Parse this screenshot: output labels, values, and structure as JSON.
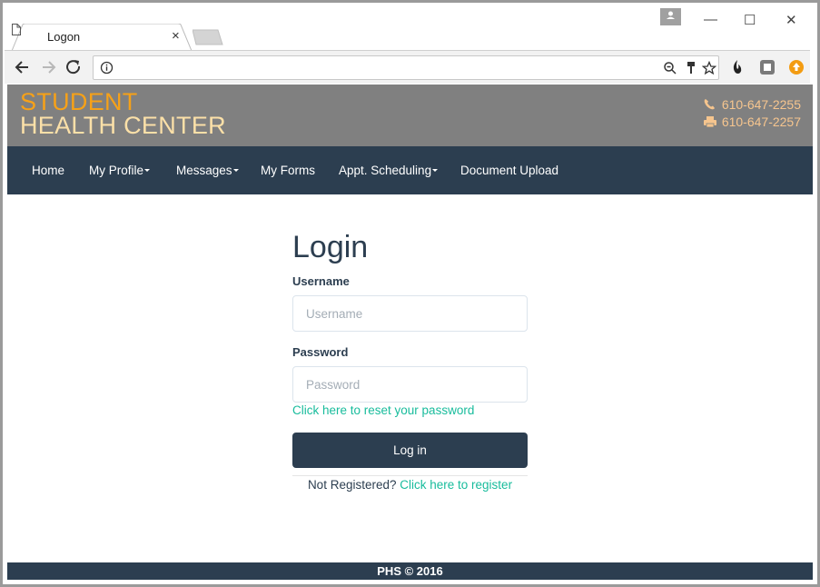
{
  "browser": {
    "tab_title": "Logon",
    "tab_close": "×",
    "window_controls": {
      "minimize": "—",
      "maximize": "☐",
      "close": "✕"
    },
    "address": {
      "value": ""
    },
    "icons": [
      "back-icon",
      "forward-icon",
      "reload-icon",
      "info-icon",
      "zoom-icon",
      "key-icon",
      "star-icon",
      "extension-flame-icon",
      "extension-square-icon",
      "extension-upload-icon"
    ]
  },
  "header": {
    "brand_line1": "STUDENT",
    "brand_line2": "HEALTH CENTER",
    "phone": "610-647-2255",
    "fax": "610-647-2257",
    "colors": {
      "brand_orange": "#f6a118",
      "brand_light": "#fbe0a8",
      "header_bg": "#808080"
    }
  },
  "nav": {
    "items": [
      {
        "label": "Home",
        "dropdown": false
      },
      {
        "label": "My Profile",
        "dropdown": true
      },
      {
        "label": "Messages",
        "dropdown": true
      },
      {
        "label": "My Forms",
        "dropdown": false
      },
      {
        "label": "Appt. Scheduling",
        "dropdown": true
      },
      {
        "label": "Document Upload",
        "dropdown": false
      }
    ],
    "bg_color": "#2c3e50"
  },
  "login": {
    "title": "Login",
    "username_label": "Username",
    "username_placeholder": "Username",
    "username_value": "",
    "password_label": "Password",
    "password_placeholder": "Password",
    "password_value": "",
    "reset_link": "Click here to reset your password",
    "submit_label": "Log in",
    "register_prefix": "Not Registered?",
    "register_link": "Click here to register",
    "accent_color": "#18bc9c"
  },
  "footer": {
    "text": "PHS © 2016"
  }
}
